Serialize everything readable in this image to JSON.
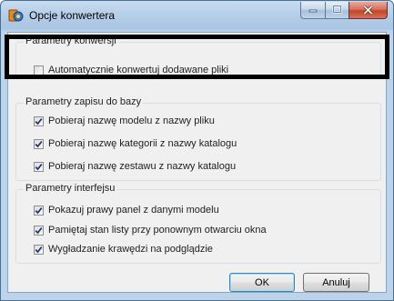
{
  "window": {
    "title": "Opcje konwertera"
  },
  "groups": [
    {
      "label": "Parametry konwersji",
      "options": [
        {
          "label": "Automatycznie konwertuj dodawane pliki",
          "checked": false
        }
      ]
    },
    {
      "label": "Parametry zapisu do bazy",
      "options": [
        {
          "label": "Pobieraj nazwę modelu z nazwy pliku",
          "checked": true
        },
        {
          "label": "Pobieraj nazwę kategorii z nazwy katalogu",
          "checked": true
        },
        {
          "label": "Pobieraj nazwę zestawu z nazwy katalogu",
          "checked": true
        }
      ]
    },
    {
      "label": "Parametry interfejsu",
      "options": [
        {
          "label": "Pokazuj prawy panel z danymi modelu",
          "checked": true
        },
        {
          "label": "Pamiętaj stan listy przy ponownym otwarciu okna",
          "checked": true
        },
        {
          "label": "Wygładzanie krawędzi na podglądzie",
          "checked": true
        }
      ]
    }
  ],
  "buttons": {
    "ok": "OK",
    "cancel": "Anuluj"
  },
  "colors": {
    "accent": "#3c7fb1",
    "highlight_border": "#000000"
  }
}
